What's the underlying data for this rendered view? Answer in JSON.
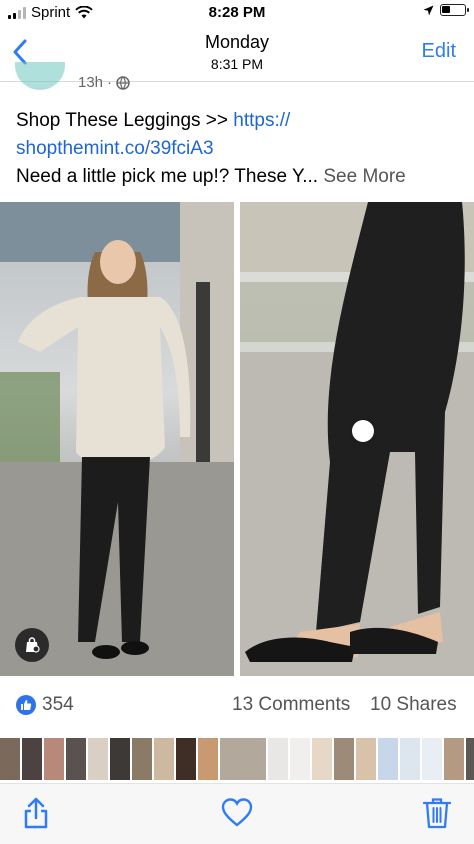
{
  "status_bar": {
    "carrier": "Sprint",
    "time": "8:28 PM",
    "icons": [
      "signal-bars-icon",
      "wifi-icon",
      "location-arrow-icon",
      "battery-icon"
    ]
  },
  "nav": {
    "title": "Monday",
    "subtitle": "8:31 PM",
    "edit_label": "Edit",
    "back_icon": "chevron-left-icon"
  },
  "post": {
    "time_ago": "13h",
    "separator": "·",
    "privacy_icon": "globe-icon",
    "line1_prefix": "Shop These Leggings >> ",
    "link_part1": "https://",
    "link_part2": "shopthemint.co/39fciA3",
    "line3": "Need a little pick me up!? These Y...",
    "see_more": "See More",
    "like_count": "354",
    "comments": "13 Comments",
    "shares": "10 Shares"
  },
  "strip_colors": [
    "#7b6a5c",
    "#4b4241",
    "#b8897a",
    "#5a5250",
    "#d9cfc4",
    "#3d3936",
    "#8a7a66",
    "#cdb9a0",
    "#3e2e26",
    "#c99a72",
    "#b3a89c",
    "#e9e7e6",
    "#f1efee",
    "#e6d7c7",
    "#9d8a79",
    "#d8c2aa",
    "#c8d6ea",
    "#dde5ef",
    "#e9eef4",
    "#b49a82",
    "#5b5856",
    "#a6a09c",
    "#9c8f88",
    "#7b6e66"
  ],
  "toolbar": {
    "share_icon": "share-icon",
    "favorite_icon": "heart-icon",
    "delete_icon": "trash-icon",
    "accent": "#2f7cf6"
  }
}
